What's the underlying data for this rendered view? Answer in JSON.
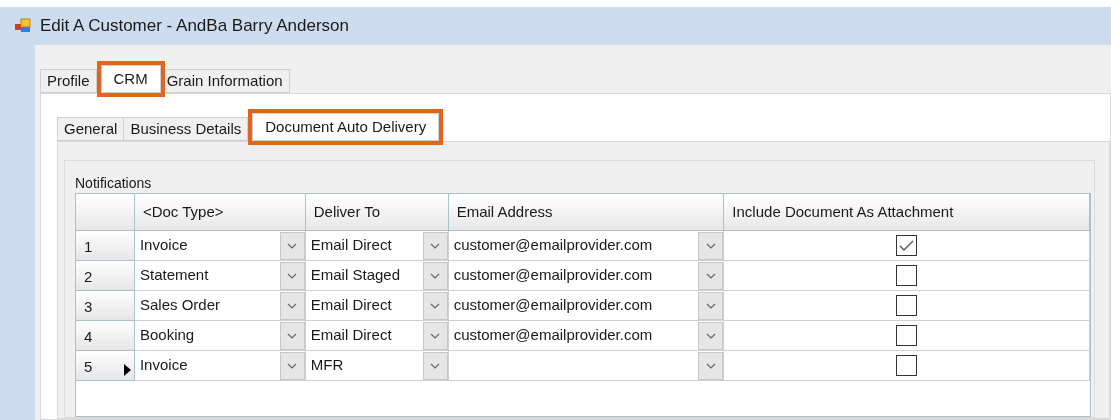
{
  "window": {
    "title": "Edit A Customer - AndBa Barry Anderson"
  },
  "tabs": [
    {
      "label": "Profile",
      "selected": false,
      "highlighted": false
    },
    {
      "label": "CRM",
      "selected": true,
      "highlighted": true
    },
    {
      "label": "Grain Information",
      "selected": false,
      "highlighted": false
    }
  ],
  "sub_tabs": [
    {
      "label": "General",
      "selected": false,
      "highlighted": false
    },
    {
      "label": "Business Details",
      "selected": false,
      "highlighted": false
    },
    {
      "label": "Document Auto Delivery",
      "selected": true,
      "highlighted": true
    }
  ],
  "group": {
    "title": "Notifications"
  },
  "table": {
    "columns": [
      "<Doc Type>",
      "Deliver To",
      "Email Address",
      "Include Document As Attachment"
    ],
    "rows": [
      {
        "row_number": "1",
        "current": false,
        "doc_type": "Invoice",
        "deliver_to": "Email Direct",
        "email_address": "customer@emailprovider.com",
        "include_attachment": true
      },
      {
        "row_number": "2",
        "current": false,
        "doc_type": "Statement",
        "deliver_to": "Email Staged",
        "email_address": "customer@emailprovider.com",
        "include_attachment": false
      },
      {
        "row_number": "3",
        "current": false,
        "doc_type": "Sales Order",
        "deliver_to": "Email Direct",
        "email_address": "customer@emailprovider.com",
        "include_attachment": false
      },
      {
        "row_number": "4",
        "current": false,
        "doc_type": "Booking",
        "deliver_to": "Email Direct",
        "email_address": "customer@emailprovider.com",
        "include_attachment": false
      },
      {
        "row_number": "5",
        "current": true,
        "doc_type": "Invoice",
        "deliver_to": "MFR",
        "email_address": "",
        "include_attachment": false
      }
    ]
  }
}
